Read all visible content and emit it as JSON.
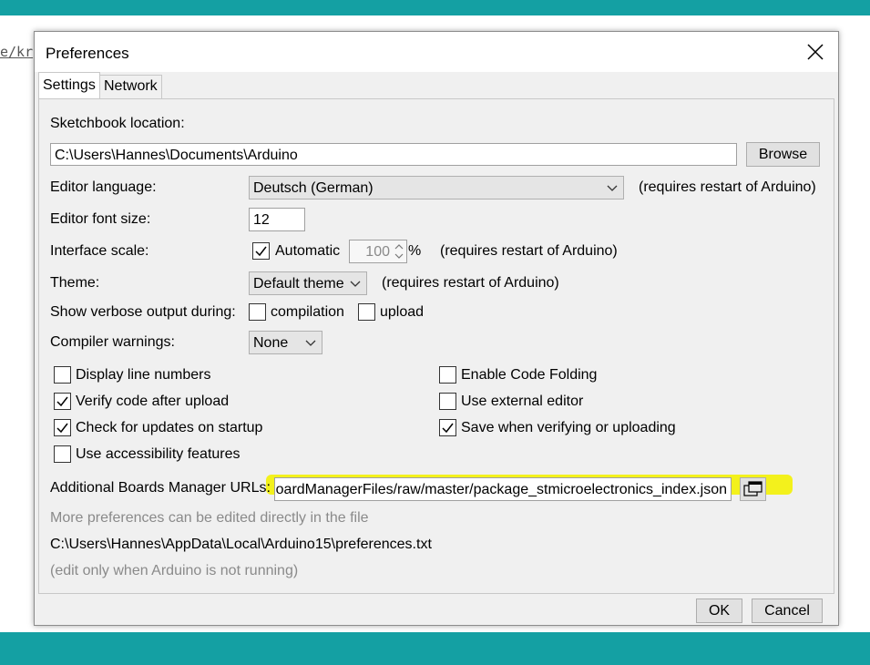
{
  "background": {
    "link_fragment": "e/kr"
  },
  "dialog": {
    "title": "Preferences",
    "tabs": [
      "Settings",
      "Network"
    ],
    "sketchbook": {
      "label": "Sketchbook location:",
      "value": "C:\\Users\\Hannes\\Documents\\Arduino",
      "browse": "Browse"
    },
    "language": {
      "label": "Editor language:",
      "value": "Deutsch (German)",
      "note": "(requires restart of Arduino)"
    },
    "font_size": {
      "label": "Editor font size:",
      "value": "12"
    },
    "scale": {
      "label": "Interface scale:",
      "automatic": "Automatic",
      "value": "100",
      "unit": "%",
      "note": "(requires restart of Arduino)"
    },
    "theme": {
      "label": "Theme:",
      "value": "Default theme",
      "note": "(requires restart of Arduino)"
    },
    "verbose": {
      "label": "Show verbose output during:",
      "compilation": "compilation",
      "upload": "upload"
    },
    "warnings": {
      "label": "Compiler warnings:",
      "value": "None"
    },
    "options_left": [
      {
        "label": "Display line numbers",
        "checked": false
      },
      {
        "label": "Verify code after upload",
        "checked": true
      },
      {
        "label": "Check for updates on startup",
        "checked": true
      },
      {
        "label": "Use accessibility features",
        "checked": false
      }
    ],
    "options_right": [
      {
        "label": "Enable Code Folding",
        "checked": false
      },
      {
        "label": "Use external editor",
        "checked": false
      },
      {
        "label": "Save when verifying or uploading",
        "checked": true
      }
    ],
    "boards": {
      "label": "Additional Boards Manager URLs:",
      "value": "BoardManagerFiles/raw/master/package_stmicroelectronics_index.json"
    },
    "more_prefs": "More preferences can be edited directly in the file",
    "prefs_path": "C:\\Users\\Hannes\\AppData\\Local\\Arduino15\\preferences.txt",
    "edit_note": "(edit only when Arduino is not running)",
    "ok": "OK",
    "cancel": "Cancel"
  },
  "colors": {
    "teal": "#14a0a3",
    "highlight": "#f3f11c"
  }
}
